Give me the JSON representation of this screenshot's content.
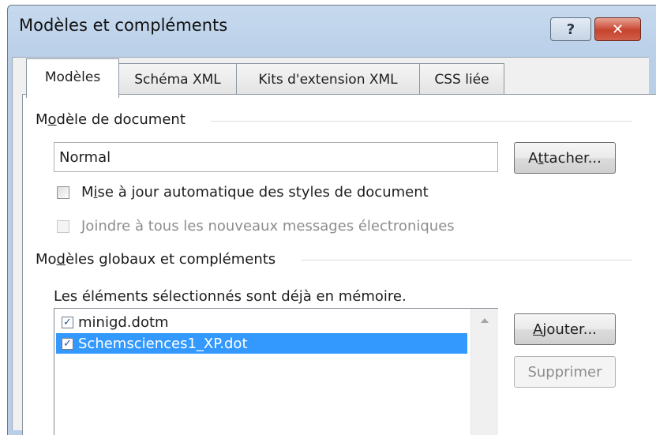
{
  "window": {
    "title": "Modèles et compléments",
    "help_glyph": "?",
    "close_glyph": "✕"
  },
  "tabs": [
    {
      "label": "Modèles",
      "active": true
    },
    {
      "label": "Schéma XML",
      "active": false
    },
    {
      "label": "Kits d'extension XML",
      "active": false
    },
    {
      "label": "CSS liée",
      "active": false
    }
  ],
  "document_template": {
    "group_label_pre": "M",
    "group_label_u": "o",
    "group_label_post": "dèle de document",
    "value": "Normal",
    "attach_pre": "A",
    "attach_u": "t",
    "attach_post": "tacher...",
    "auto_update_pre": "M",
    "auto_update_u": "i",
    "auto_update_post": "se à jour automatique des styles de document",
    "auto_update_checked": false,
    "attach_mail_label": "Joindre à tous les nouveaux messages électroniques",
    "attach_mail_enabled": false
  },
  "global_templates": {
    "group_label_pre": "Mo",
    "group_label_u": "d",
    "group_label_post": "èles globaux et compléments",
    "hint": "Les éléments sélectionnés sont déjà en mémoire.",
    "items": [
      {
        "name": "minigd.dotm",
        "checked": true,
        "selected": false
      },
      {
        "name": "Schemsciences1_XP.dot",
        "checked": true,
        "selected": true
      }
    ],
    "add_u": "A",
    "add_post": "jouter...",
    "remove_label": "Supprimer",
    "remove_enabled": false
  },
  "colors": {
    "selection": "#3399ff",
    "titlebar": "#b9cfe8",
    "close_button": "#c7432e"
  }
}
